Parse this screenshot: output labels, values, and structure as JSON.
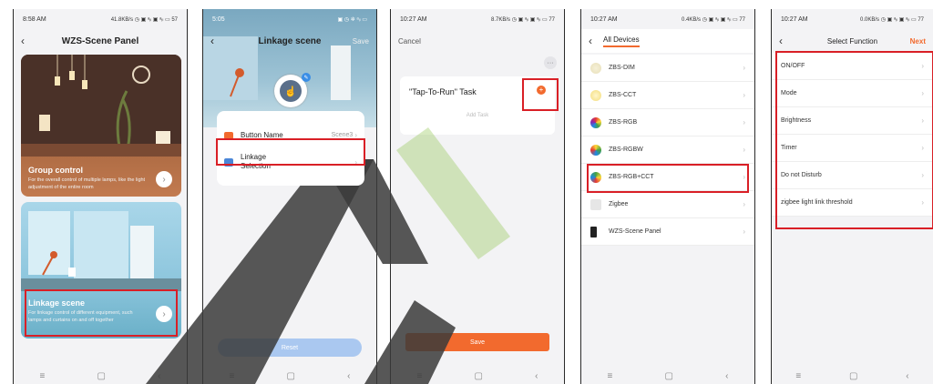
{
  "phone1": {
    "status_time": "8:58 AM",
    "status_right": "41.8KB/s ◷ ▣ ᵃᵢₗ ▣ ᵃᵢₗ ▭ 57",
    "title": "WZS-Scene Panel",
    "group": {
      "title": "Group control",
      "desc": "For the overall control of multiple lamps, like the light adjustment of the entire room"
    },
    "linkage": {
      "title": "Linkage scene",
      "desc": "For linkage control of different equipment, such lamps and curtains on and off together"
    }
  },
  "phone2": {
    "status_time": "5:05",
    "title": "Linkage scene",
    "save": "Save",
    "button_name_label": "Button Name",
    "button_name_value": "Scene3",
    "linkage_selection": "Linkage Selection",
    "reset": "Reset"
  },
  "phone3": {
    "status_time": "10:27 AM",
    "status_right": "8.7KB/s ◷ ▣ ᵃᵢₗ ▣ ᵃᵢₗ ▭ 77",
    "cancel": "Cancel",
    "more": "···",
    "task_title": "\"Tap-To-Run\" Task",
    "add_task": "Add Task",
    "save": "Save"
  },
  "phone4": {
    "status_time": "10:27 AM",
    "status_right": "0.4KB/s ◷ ▣ ᵃᵢₗ ▣ ᵃᵢₗ ▭ 77",
    "title": "All Devices",
    "devices": [
      "ZBS-DIM",
      "ZBS-CCT",
      "ZBS-RGB",
      "ZBS-RGBW",
      "ZBS-RGB+CCT",
      "Zigbee",
      "WZS-Scene Panel"
    ]
  },
  "phone5": {
    "status_time": "10:27 AM",
    "status_right": "0.0KB/s ◷ ▣ ᵃᵢₗ ▣ ᵃᵢₗ ▭ 77",
    "title": "Select Function",
    "next": "Next",
    "functions": [
      "ON/OFF",
      "Mode",
      "Brightness",
      "Timer",
      "Do not Disturb",
      "zigbee light link threshold"
    ]
  },
  "home_icons": [
    "≡",
    "▢",
    "‹"
  ],
  "colors": {
    "accent_orange": "#f26a2e",
    "highlight_red": "#d91f26",
    "reset_blue": "#aac8f0"
  }
}
